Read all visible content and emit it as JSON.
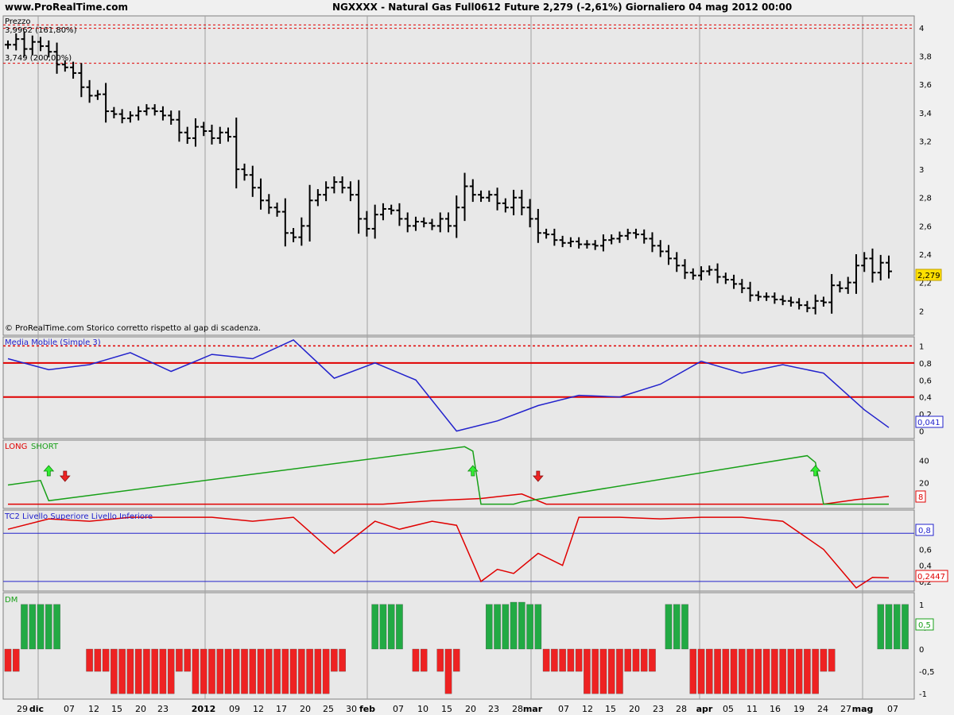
{
  "header": {
    "site": "www.ProRealTime.com",
    "title": "NGXXXX - Natural Gas Full0612 Future    2,279 (-2,61%)   Giornaliero  04 mag 2012 00:00"
  },
  "colors": {
    "panel_bg": "#e8e8e8",
    "price_bar": "#000000",
    "ma_line": "#2222cc",
    "ref_red": "#e00000",
    "long_line": "#e00000",
    "short_line": "#18a018",
    "dm_pos": "#22aa44",
    "dm_neg": "#ee2222",
    "tc2_line": "#e00000",
    "tc2_levels": "#2222cc"
  },
  "price_panel": {
    "labels": [
      "Prezzo",
      "3,9962 (161,80%)",
      "3,749 (200,00%)"
    ],
    "footer": "© ProRealTime.com  Storico corretto rispetto al gap di scadenza.",
    "current_value": "2,279",
    "yticks": [
      "4",
      "3,8",
      "3,6",
      "3,4",
      "3,2",
      "3",
      "2,8",
      "2,6",
      "2,4",
      "2,2",
      "2"
    ],
    "fib_levels": [
      4.02,
      3.9962,
      3.749
    ]
  },
  "ma_panel": {
    "label": "Media Mobile (Simple 3)",
    "current_value": "0,041",
    "yticks": [
      "1",
      "0,8",
      "0,6",
      "0,4",
      "0,2",
      "0"
    ],
    "ref_levels": [
      1,
      0.8,
      0.4
    ]
  },
  "ls_panel": {
    "label_long": "LONG",
    "label_short": "SHORT",
    "current_value": "8",
    "yticks": [
      "40",
      "20"
    ]
  },
  "tc2_panel": {
    "label": "TC2 Livello Superiore Livello Inferiore",
    "current_value": "0,2447",
    "level_value": "0,8",
    "yticks": [
      "0,8",
      "0,6",
      "0,4",
      "0,2"
    ],
    "levels": [
      0.8,
      0.2
    ]
  },
  "dm_panel": {
    "label": "DM",
    "current_value": "0,5",
    "yticks": [
      "1",
      "0,5",
      "0",
      "-0,5",
      "-1"
    ]
  },
  "x_axis": {
    "labels": [
      "29",
      "dic",
      "07",
      "12",
      "15",
      "20",
      "23",
      "2012",
      "09",
      "12",
      "17",
      "20",
      "25",
      "30",
      "feb",
      "07",
      "10",
      "15",
      "20",
      "23",
      "28",
      "mar",
      "07",
      "12",
      "15",
      "20",
      "23",
      "28",
      "apr",
      "05",
      "11",
      "16",
      "19",
      "24",
      "27",
      "mag",
      "07"
    ],
    "bold": [
      "dic",
      "2012",
      "feb",
      "mar",
      "apr",
      "mag"
    ]
  },
  "chart_data": [
    {
      "type": "bar",
      "subtype": "ohlc",
      "title": "NGXXXX - Natural Gas Full0612 Future",
      "ylim": [
        1.85,
        4.05
      ],
      "dates": [
        "2011-11-29",
        "2011-11-30",
        "2011-12-01",
        "2011-12-02",
        "2011-12-05",
        "2011-12-06",
        "2011-12-07",
        "2011-12-08",
        "2011-12-09",
        "2011-12-12",
        "2011-12-13",
        "2011-12-14",
        "2011-12-15",
        "2011-12-16",
        "2011-12-19",
        "2011-12-20",
        "2011-12-21",
        "2011-12-22",
        "2011-12-23",
        "2011-12-27",
        "2011-12-28",
        "2011-12-29",
        "2011-12-30",
        "2012-01-03",
        "2012-01-04",
        "2012-01-05",
        "2012-01-06",
        "2012-01-09",
        "2012-01-10",
        "2012-01-11",
        "2012-01-12",
        "2012-01-13",
        "2012-01-17",
        "2012-01-18",
        "2012-01-19",
        "2012-01-20",
        "2012-01-23",
        "2012-01-24",
        "2012-01-25",
        "2012-01-26",
        "2012-01-27",
        "2012-01-30",
        "2012-01-31",
        "2012-02-01",
        "2012-02-02",
        "2012-02-03",
        "2012-02-06",
        "2012-02-07",
        "2012-02-08",
        "2012-02-09",
        "2012-02-10",
        "2012-02-13",
        "2012-02-14",
        "2012-02-15",
        "2012-02-16",
        "2012-02-17",
        "2012-02-21",
        "2012-02-22",
        "2012-02-23",
        "2012-02-24",
        "2012-02-27",
        "2012-02-28",
        "2012-02-29",
        "2012-03-01",
        "2012-03-02",
        "2012-03-05",
        "2012-03-06",
        "2012-03-07",
        "2012-03-08",
        "2012-03-09",
        "2012-03-12",
        "2012-03-13",
        "2012-03-14",
        "2012-03-15",
        "2012-03-16",
        "2012-03-19",
        "2012-03-20",
        "2012-03-21",
        "2012-03-22",
        "2012-03-23",
        "2012-03-26",
        "2012-03-27",
        "2012-03-28",
        "2012-03-29",
        "2012-03-30",
        "2012-04-02",
        "2012-04-03",
        "2012-04-04",
        "2012-04-05",
        "2012-04-09",
        "2012-04-10",
        "2012-04-11",
        "2012-04-12",
        "2012-04-13",
        "2012-04-16",
        "2012-04-17",
        "2012-04-18",
        "2012-04-19",
        "2012-04-20",
        "2012-04-23",
        "2012-04-24",
        "2012-04-25",
        "2012-04-26",
        "2012-04-27",
        "2012-04-30",
        "2012-05-01",
        "2012-05-02",
        "2012-05-03",
        "2012-05-04"
      ],
      "close": [
        3.88,
        3.92,
        3.85,
        3.9,
        3.87,
        3.83,
        3.74,
        3.72,
        3.68,
        3.58,
        3.52,
        3.53,
        3.41,
        3.39,
        3.36,
        3.38,
        3.41,
        3.43,
        3.41,
        3.38,
        3.35,
        3.26,
        3.22,
        3.3,
        3.27,
        3.22,
        3.26,
        3.23,
        3.0,
        2.96,
        2.87,
        2.78,
        2.73,
        2.7,
        2.55,
        2.52,
        2.6,
        2.78,
        2.82,
        2.87,
        2.91,
        2.87,
        2.82,
        2.65,
        2.58,
        2.68,
        2.72,
        2.71,
        2.65,
        2.6,
        2.63,
        2.62,
        2.6,
        2.65,
        2.6,
        2.73,
        2.88,
        2.82,
        2.8,
        2.82,
        2.76,
        2.73,
        2.8,
        2.73,
        2.65,
        2.55,
        2.54,
        2.5,
        2.48,
        2.49,
        2.47,
        2.47,
        2.46,
        2.5,
        2.51,
        2.53,
        2.55,
        2.54,
        2.51,
        2.46,
        2.42,
        2.37,
        2.32,
        2.27,
        2.25,
        2.28,
        2.29,
        2.24,
        2.22,
        2.19,
        2.16,
        2.11,
        2.1,
        2.1,
        2.08,
        2.07,
        2.06,
        2.04,
        2.02,
        2.07,
        2.06,
        2.18,
        2.16,
        2.2,
        2.32,
        2.37,
        2.27,
        2.34,
        2.279
      ]
    },
    {
      "type": "line",
      "title": "Media Mobile (Simple 3)",
      "ylim": [
        -0.05,
        1.05
      ],
      "x": [
        0,
        5,
        10,
        15,
        20,
        25,
        30,
        35,
        40,
        45,
        50,
        55,
        60,
        65,
        70,
        75,
        80,
        85,
        90,
        95,
        100,
        105,
        108
      ],
      "y": [
        0.85,
        0.72,
        0.78,
        0.92,
        0.7,
        0.9,
        0.85,
        1.07,
        0.62,
        0.8,
        0.6,
        0.0,
        0.12,
        0.3,
        0.42,
        0.4,
        0.55,
        0.82,
        0.68,
        0.78,
        0.68,
        0.25,
        0.041
      ]
    },
    {
      "type": "line",
      "title": "LONG SHORT",
      "ylim": [
        0,
        55
      ],
      "series": [
        {
          "name": "LONG",
          "x": [
            0,
            46,
            52,
            58,
            63,
            66,
            68,
            100,
            104,
            108
          ],
          "y": [
            1,
            1,
            4,
            6,
            10,
            1,
            1,
            1,
            5,
            8
          ]
        },
        {
          "name": "SHORT",
          "x": [
            0,
            4,
            5,
            56,
            57,
            58,
            62,
            63,
            98,
            99,
            100,
            108
          ],
          "y": [
            18,
            22,
            4,
            52,
            48,
            1,
            1,
            3,
            44,
            38,
            1,
            1
          ]
        }
      ],
      "annotations": [
        {
          "type": "arrow-up",
          "x": 5,
          "color": "green"
        },
        {
          "type": "arrow-down",
          "x": 7,
          "color": "red"
        },
        {
          "type": "arrow-up",
          "x": 57,
          "color": "green"
        },
        {
          "type": "arrow-down",
          "x": 65,
          "color": "red"
        },
        {
          "type": "arrow-up",
          "x": 99,
          "color": "green"
        }
      ]
    },
    {
      "type": "line",
      "title": "TC2 Livello Superiore Livello Inferiore",
      "ylim": [
        0.1,
        1.05
      ],
      "x": [
        0,
        5,
        10,
        15,
        20,
        25,
        30,
        35,
        40,
        45,
        48,
        52,
        55,
        58,
        60,
        62,
        65,
        68,
        70,
        75,
        80,
        85,
        90,
        95,
        100,
        104,
        106,
        108
      ],
      "y": [
        0.85,
        0.98,
        0.95,
        1.0,
        1.0,
        1.0,
        0.95,
        1.0,
        0.55,
        0.95,
        0.85,
        0.95,
        0.9,
        0.2,
        0.35,
        0.3,
        0.55,
        0.4,
        1.0,
        1.0,
        0.98,
        1.0,
        1.0,
        0.95,
        0.6,
        0.12,
        0.25,
        0.2447
      ]
    },
    {
      "type": "bar",
      "title": "DM",
      "ylim": [
        -1.05,
        1.05
      ],
      "values": [
        -0.5,
        -0.5,
        1,
        1,
        1,
        1,
        1,
        0,
        0,
        0,
        -0.5,
        -0.5,
        -0.5,
        -1,
        -1,
        -1,
        -1,
        -1,
        -1,
        -1,
        -1,
        -0.5,
        -0.5,
        -1,
        -1,
        -1,
        -1,
        -1,
        -1,
        -1,
        -1,
        -1,
        -1,
        -1,
        -1,
        -1,
        -1,
        -1,
        -1,
        -1,
        -0.5,
        -0.5,
        0,
        0,
        0,
        1,
        1,
        1,
        1,
        0,
        -0.5,
        -0.5,
        0,
        -0.5,
        -1,
        -0.5,
        0,
        0,
        0,
        1,
        1,
        1,
        2,
        2,
        1,
        1,
        -0.5,
        -0.5,
        -0.5,
        -0.5,
        -0.5,
        -1,
        -1,
        -1,
        -1,
        -1,
        -0.5,
        -0.5,
        -0.5,
        -0.5,
        0,
        1,
        1,
        1,
        -1,
        -1,
        -1,
        -1,
        -1,
        -1,
        -1,
        -1,
        -1,
        -1,
        -1,
        -1,
        -1,
        -1,
        -1,
        -1,
        -0.5,
        -0.5,
        0,
        0,
        0,
        0,
        0,
        1,
        1,
        1,
        1
      ]
    }
  ]
}
